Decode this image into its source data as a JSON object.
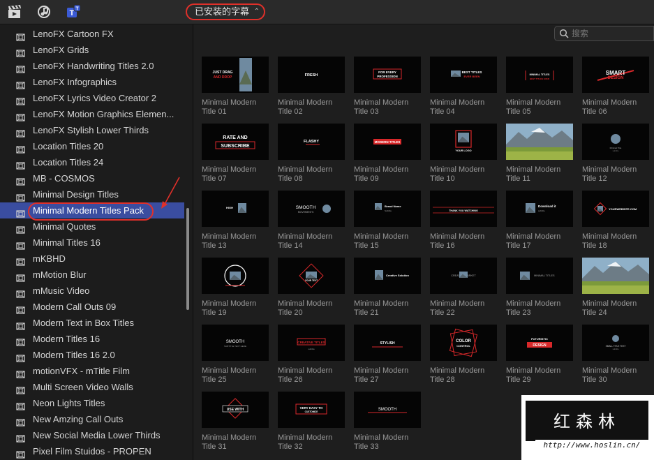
{
  "toolbar": {
    "icons": [
      "clapper-icon",
      "music-notes-icon",
      "titles-icon"
    ],
    "category_popup": "已安装的字幕",
    "popup_chevron": "⌃⌄"
  },
  "search": {
    "placeholder": "搜索"
  },
  "sidebar": {
    "selected_index": 12,
    "items": [
      "LenoFX Cartoon FX",
      "LenoFX Grids",
      "LenoFX Handwriting Titles 2.0",
      "LenoFX Infographics",
      "LenoFX Lyrics Video Creator 2",
      "LenoFX Motion Graphics Elemen...",
      "LenoFX Stylish Lower Thirds",
      "Location Titles 20",
      "Location Titles 24",
      "MB - COSMOS",
      "Minimal Design Titles",
      "Minimal Modern Titles Pack",
      "Minimal Quotes",
      "Minimal Titles 16",
      "mKBHD",
      "mMotion Blur",
      "mMusic Video",
      "Modern Call Outs 09",
      "Modern Text in Box Titles",
      "Modern Titles 16",
      "Modern Titles 16 2.0",
      "motionVFX - mTitle Film",
      "Multi Screen Video Walls",
      "Neon Lights Titles",
      "New Amzing Call Outs",
      "New Social Media Lower Thirds",
      "Pixel Film Stuidos - PROPEN"
    ]
  },
  "tiles": [
    {
      "line1": "Minimal Modern",
      "line2": "Title 01",
      "text": "JUST DRAG|AND DROP"
    },
    {
      "line1": "Minimal Modern",
      "line2": "Title 02",
      "text": "FRESH | DESIGN"
    },
    {
      "line1": "Minimal Modern",
      "line2": "Title 03",
      "text": "FOR EVERY|PROFESSION"
    },
    {
      "line1": "Minimal Modern",
      "line2": "Title 04",
      "text": "BEST TITLES|EVER BEEN"
    },
    {
      "line1": "Minimal Modern",
      "line2": "Title 05",
      "text": "MINIMAL TITLES"
    },
    {
      "line1": "Minimal Modern",
      "line2": "Title 06",
      "text": "SMART|DESIGN"
    },
    {
      "line1": "Minimal Modern",
      "line2": "Title 07",
      "text": "RATE AND|SUBSCRIBE"
    },
    {
      "line1": "Minimal Modern",
      "line2": "Title 08",
      "text": "FLASHY"
    },
    {
      "line1": "Minimal Modern",
      "line2": "Title 09",
      "text": "MODERN TITLES"
    },
    {
      "line1": "Minimal Modern",
      "line2": "Title 10",
      "text": "YOUR LOGO"
    },
    {
      "line1": "Minimal Modern",
      "line2": "Title 11",
      "text": ""
    },
    {
      "line1": "Minimal Modern",
      "line2": "Title 12",
      "text": ""
    },
    {
      "line1": "Minimal Modern",
      "line2": "Title 13",
      "text": "HIGH"
    },
    {
      "line1": "Minimal Modern",
      "line2": "Title 14",
      "text": "SMOOTH|MOVEMENTS"
    },
    {
      "line1": "Minimal Modern",
      "line2": "Title 15",
      "text": "Brand Name"
    },
    {
      "line1": "Minimal Modern",
      "line2": "Title 16",
      "text": "THANK YOU  WATCHING"
    },
    {
      "line1": "Minimal Modern",
      "line2": "Title 17",
      "text": "Download it"
    },
    {
      "line1": "Minimal Modern",
      "line2": "Title 18",
      "text": "YOURWEBSITE.COM"
    },
    {
      "line1": "Minimal Modern",
      "line2": "Title 19",
      "text": ""
    },
    {
      "line1": "Minimal Modern",
      "line2": "Title 20",
      "text": ""
    },
    {
      "line1": "Minimal Modern",
      "line2": "Title 21",
      "text": "Creative Solution"
    },
    {
      "line1": "Minimal Modern",
      "line2": "Title 22",
      "text": "CREATIVE  MARKET"
    },
    {
      "line1": "Minimal Modern",
      "line2": "Title 23",
      "text": "MINIMAL TITLES"
    },
    {
      "line1": "Minimal Modern",
      "line2": "Title 24",
      "text": ""
    },
    {
      "line1": "Minimal Modern",
      "line2": "Title 25",
      "text": "SMOOTH"
    },
    {
      "line1": "Minimal Modern",
      "line2": "Title 26",
      "text": "CREATIVE TITLES"
    },
    {
      "line1": "Minimal Modern",
      "line2": "Title 27",
      "text": "STYLISH"
    },
    {
      "line1": "Minimal Modern",
      "line2": "Title 28",
      "text": "COLOR|CONTROL"
    },
    {
      "line1": "Minimal Modern",
      "line2": "Title 29",
      "text": "FUTURISTIC|DESIGN"
    },
    {
      "line1": "Minimal Modern",
      "line2": "Title 30",
      "text": ""
    },
    {
      "line1": "Minimal Modern",
      "line2": "Title 31",
      "text": "USE WITH"
    },
    {
      "line1": "Minimal Modern",
      "line2": "Title 32",
      "text": "VERY EASY TO"
    },
    {
      "line1": "Minimal Modern",
      "line2": "Title 33",
      "text": "SMOOTH"
    }
  ],
  "watermark": {
    "title": "红森林",
    "url": "http://www.hoslin.cn/"
  },
  "colors": {
    "accent_red": "#e0302a",
    "selection_blue": "#3a4da0",
    "background": "#1e1e1e"
  }
}
